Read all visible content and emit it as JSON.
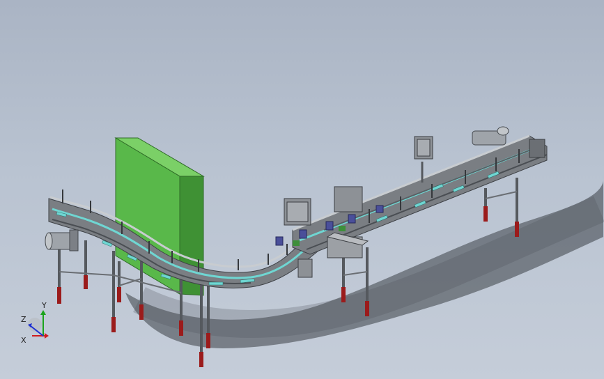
{
  "viewport": {
    "background_top": "#aab4c4",
    "background_bottom": "#c5cdd9"
  },
  "model": {
    "frame_color": "#6f7378",
    "belt_accent_color": "#6fd6d2",
    "guard_panel_color": "#59b84a",
    "leg_foot_color": "#9b1b1b",
    "motor_color": "#9fa4aa"
  },
  "triad": {
    "x_label": "X",
    "y_label": "Y",
    "z_label": "Z",
    "x_color": "#d11d1d",
    "y_color": "#1aa31a",
    "z_color": "#1d2fd1"
  }
}
